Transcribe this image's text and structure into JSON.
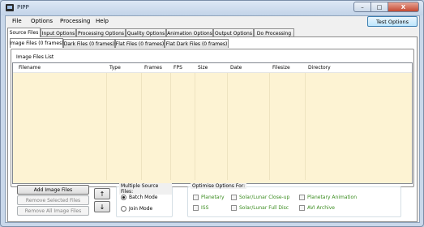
{
  "window": {
    "title": "PIPP",
    "close_glyph": "X",
    "min_glyph": "–",
    "max_glyph": "□"
  },
  "menu": {
    "items": [
      "File",
      "Options",
      "Processing",
      "Help"
    ],
    "test_options_label": "Test Options"
  },
  "main_tabs": [
    "Source Files",
    "Input Options",
    "Processing Options",
    "Quality Options",
    "Animation Options",
    "Output Options",
    "Do Processing"
  ],
  "sub_tabs": [
    "Image Files (0 frames)",
    "Dark Files (0 frames)",
    "Flat Files (0 frames)",
    "Flat Dark Files (0 frames)"
  ],
  "image_list": {
    "group_label": "Image Files List",
    "columns": [
      "Filename",
      "Type",
      "Frames",
      "FPS",
      "Size",
      "Date",
      "Filesize",
      "Directory"
    ]
  },
  "buttons": {
    "add": "Add Image Files",
    "remove_selected": "Remove Selected Files",
    "remove_all": "Remove All Image Files",
    "up_glyph": "↑",
    "down_glyph": "↓"
  },
  "multiple_source": {
    "label": "Multiple Source Files:",
    "batch": "Batch Mode",
    "join": "Join Mode",
    "selected": "batch"
  },
  "optimise": {
    "label": "Optimise Options For:",
    "options": [
      "Planetary",
      "ISS",
      "Solar/Lunar Close-up",
      "Solar/Lunar Full Disc",
      "Planetary Animation",
      "AVI Archive"
    ]
  },
  "colors": {
    "list_background": "#fdf3d3",
    "option_text": "#3a8c1f",
    "accent": "#3c7fb1"
  }
}
